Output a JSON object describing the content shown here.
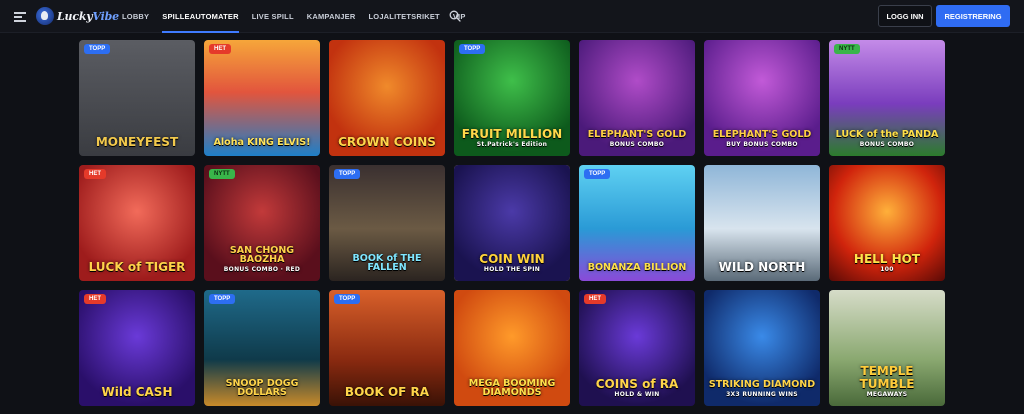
{
  "header": {
    "logo_text_1": "Lucky",
    "logo_text_2": "Vibe",
    "nav": [
      "LOBBY",
      "SPILLEAUTOMATER",
      "LIVE SPILL",
      "KAMPANJER",
      "LOJALITETSRIKET",
      "VIP"
    ],
    "active_nav": "SPILLEAUTOMATER",
    "login_label": "LOGG INN",
    "register_label": "REGISTRERING",
    "accent_color": "#2f6cf3"
  },
  "games": [
    {
      "title": "MONEYFEST",
      "sub": "",
      "tag": "TOPP",
      "bg": "linear-gradient(180deg,#5b5d63,#3a3c41)",
      "color": "#f2c94c"
    },
    {
      "title": "Aloha KING ELVIS!",
      "sub": "",
      "tag": "HET",
      "bg": "linear-gradient(180deg,#f6a63a,#e2553d 45%,#1e7fc8)",
      "color": "#ffe35a"
    },
    {
      "title": "CROWN COINS",
      "sub": "",
      "tag": "",
      "bg": "radial-gradient(circle at 50% 40%,#f08a2b,#c2320f 70%)",
      "color": "#ffd54a"
    },
    {
      "title": "FRUIT MILLION",
      "sub": "St.Patrick's Edition",
      "tag": "TOPP",
      "bg": "radial-gradient(circle at 50% 35%,#3fbf4a,#0d5a1c 75%)",
      "color": "#ffd84a"
    },
    {
      "title": "ELEPHANT'S GOLD",
      "sub": "BONUS COMBO",
      "tag": "",
      "bg": "radial-gradient(circle at 50% 35%,#b04cc8,#4b1a7a 75%)",
      "color": "#ffcf45"
    },
    {
      "title": "ELEPHANT'S GOLD",
      "sub": "BUY BONUS COMBO",
      "tag": "",
      "bg": "radial-gradient(circle at 50% 35%,#c25ad8,#5a1d8c 75%)",
      "color": "#ffcf45"
    },
    {
      "title": "LUCK of the PANDA",
      "sub": "BONUS COMBO",
      "tag": "NYTT",
      "bg": "linear-gradient(180deg,#c48be8,#7a3dbd 55%,#2c7c2c)",
      "color": "#ffe04a"
    },
    {
      "title": "LUCK of TIGER",
      "sub": "",
      "tag": "HET",
      "bg": "radial-gradient(circle at 50% 40%,#f26b5a,#9e1c1c 75%)",
      "color": "#ffd34a"
    },
    {
      "title": "SAN CHONG BAOZHA",
      "sub": "BONUS COMBO · RED",
      "tag": "NYTT",
      "bg": "radial-gradient(circle at 50% 40%,#c23a3a,#5a0f1c 75%)",
      "color": "#ffd24a"
    },
    {
      "title": "BOOK of THE FALLEN",
      "sub": "",
      "tag": "TOPP",
      "bg": "linear-gradient(180deg,#3a3030,#6b5a44 55%,#2b2420)",
      "color": "#7fe6ff"
    },
    {
      "title": "COIN WIN",
      "sub": "HOLD THE SPIN",
      "tag": "",
      "bg": "radial-gradient(circle at 50% 40%,#4b3aa8,#1a1350 75%)",
      "color": "#ffd23a"
    },
    {
      "title": "BONANZA BILLION",
      "sub": "",
      "tag": "TOPP",
      "bg": "linear-gradient(180deg,#5fd1f2,#2a9ad6 55%,#8a4ad8)",
      "color": "#ffe24a"
    },
    {
      "title": "WILD NORTH",
      "sub": "",
      "tag": "",
      "bg": "linear-gradient(180deg,#8fb6d8,#d8e4ee 55%,#5a6a78)",
      "color": "#ffffff"
    },
    {
      "title": "HELL HOT",
      "sub": "100",
      "tag": "",
      "bg": "radial-gradient(circle at 50% 40%,#ffb03a,#d0240c 60%,#5a0a06)",
      "color": "#ffe34a"
    },
    {
      "title": "Wild CASH",
      "sub": "",
      "tag": "HET",
      "bg": "radial-gradient(circle at 50% 40%,#6a3ad8,#2a0f6a 75%)",
      "color": "#ffd54a"
    },
    {
      "title": "SNOOP DOGG DOLLARS",
      "sub": "",
      "tag": "TOPP",
      "bg": "linear-gradient(180deg,#1f6a8a,#0f3a4a 60%,#c88a2a)",
      "color": "#ffd54a"
    },
    {
      "title": "BOOK OF RA",
      "sub": "",
      "tag": "TOPP",
      "bg": "linear-gradient(180deg,#d8602a,#8a2a10 60%,#3a1206)",
      "color": "#ffd54a"
    },
    {
      "title": "MEGA BOOMING DIAMONDS",
      "sub": "",
      "tag": "",
      "bg": "radial-gradient(circle at 50% 40%,#ff9a2a,#d04a10 70%)",
      "color": "#ffe04a"
    },
    {
      "title": "COINS of RA",
      "sub": "HOLD & WIN",
      "tag": "HET",
      "bg": "radial-gradient(circle at 50% 40%,#6a3ad8,#1f1050 75%)",
      "color": "#ffd54a"
    },
    {
      "title": "STRIKING DIAMOND",
      "sub": "3X3 RUNNING WINS",
      "tag": "",
      "bg": "radial-gradient(circle at 50% 40%,#3a8ae8,#0f2a6a 75%)",
      "color": "#ffd54a"
    },
    {
      "title": "TEMPLE TUMBLE",
      "sub": "MEGAWAYS",
      "tag": "",
      "bg": "linear-gradient(180deg,#d6dcc8,#8aa870 60%,#4a6a3a)",
      "color": "#ffcc3a"
    }
  ]
}
